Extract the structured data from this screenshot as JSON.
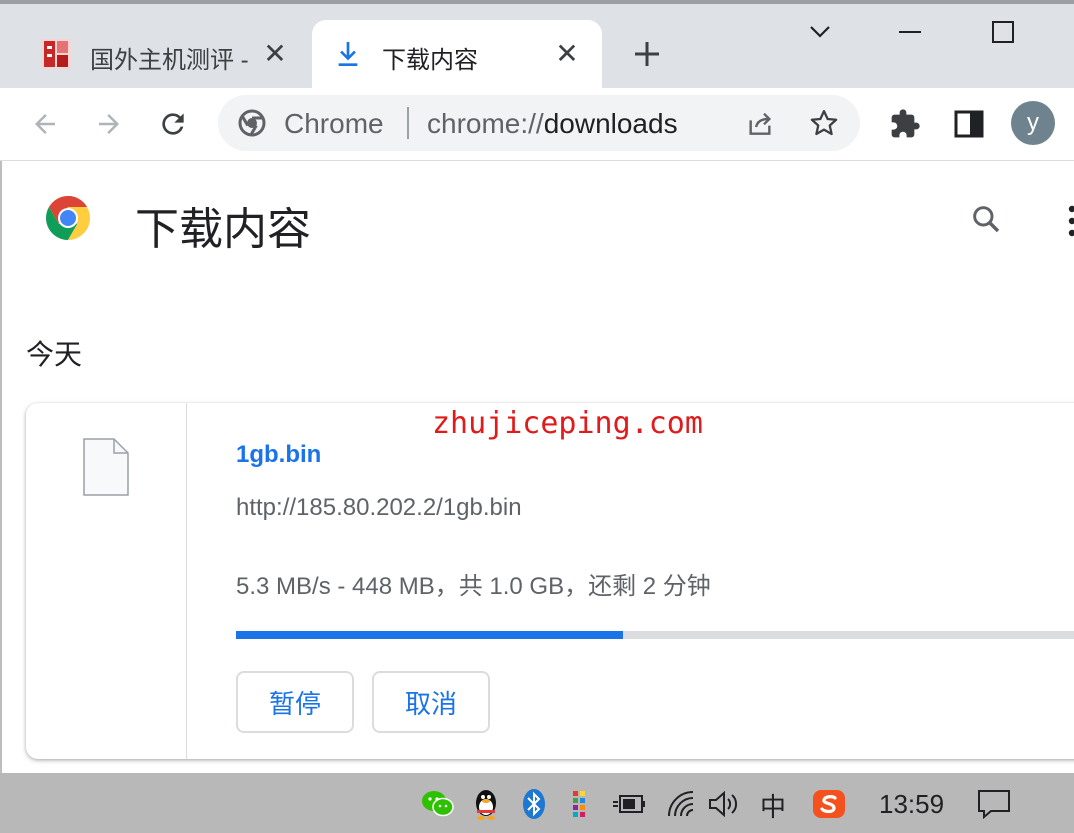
{
  "browser": {
    "tabs": [
      {
        "title": "国外主机测评 -",
        "active": false,
        "icon": "site-favicon"
      },
      {
        "title": "下载内容",
        "active": true,
        "icon": "download-icon"
      }
    ],
    "omnibox": {
      "chip": "Chrome",
      "url_scheme": "chrome://",
      "url_host": "downloads"
    },
    "profile_initial": "y"
  },
  "downloads_page": {
    "title": "下载内容",
    "section_date": "今天",
    "items": [
      {
        "file_name": "1gb.bin",
        "url": "http://185.80.202.2/1gb.bin",
        "status": "5.3 MB/s - 448 MB，共 1.0 GB，还剩 2 分钟",
        "progress": 0.448,
        "pause_label": "暂停",
        "cancel_label": "取消"
      }
    ]
  },
  "watermark": "zhujiceping.com",
  "taskbar": {
    "ime": "中",
    "time": "13:59"
  },
  "colors": {
    "accent": "#1a73e8",
    "tabstrip": "#dee1e6",
    "watermark": "#e01b1b"
  }
}
